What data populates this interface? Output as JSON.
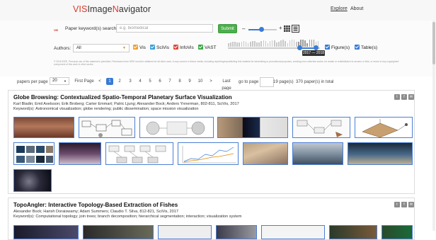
{
  "nav": {
    "brand": {
      "p1": "VIS",
      "p2": "Image",
      "p3": "N",
      "p4": "avigator"
    },
    "explore": "Explore",
    "about": "About"
  },
  "search": {
    "logo_text": "VIS",
    "label": "Paper keyword(s) search:",
    "placeholder": "e.g. biomedical",
    "submit": "Submit",
    "minus": "–",
    "plus": "+"
  },
  "filters": {
    "authors_label": "Authors:",
    "authors_value": "All",
    "venues": [
      {
        "label": "Vis",
        "color": "#f0a030"
      },
      {
        "label": "SciVis",
        "color": "#3a9fd8"
      },
      {
        "label": "InfoVis",
        "color": "#e0483a"
      },
      {
        "label": "VAST",
        "color": "#3aa845"
      }
    ],
    "year_range_text": "2017 — 2018",
    "year_range_fraction": [
      0.78,
      0.96
    ],
    "figure_label": "Figure(s)",
    "table_label": "Table(s)",
    "type_color": "#3a7bd5"
  },
  "disclaimer": "© 2018 IEEE. Personal use of this material is permitted. Permission from IEEE must be obtained for all other uses, in any current or future media, including reprinting/republishing this material for advertising or promotional purposes, creating new collective works, for resale or redistribution to servers or lists, or reuse of any copyrighted component of this work in other works.",
  "pager": {
    "per_page_label": "papers per page",
    "per_page_value": "20",
    "first": "First Page",
    "prev": "<",
    "pages": [
      "1",
      "2",
      "3",
      "4",
      "5",
      "6",
      "7",
      "8",
      "9",
      "10"
    ],
    "next": ">",
    "last": "Last page",
    "goto": "go to page",
    "total_pages": "19 page(s)",
    "total_papers": "370 paper(s) in total"
  },
  "papers": [
    {
      "title": "Globe Browsing: Contextualized Spatio-Temporal Planetary Surface Visualization",
      "authors": "Karl Bladin; Emil Axelsson; Erik Broberg; Carter Emmart; Patric Ljung; Alexander Bock; Anders Ynnerman, 802-811, SciVis, 2017",
      "keywords": "Keyword(s): Astronomical visualization; globe rendering; public dissemination; space mission visualization"
    },
    {
      "title": "TopoAngler: Interactive Topology-Based Extraction of Fishes",
      "authors": "Alexander Bock; Harish Doraiswamy; Adam Summers; Claudio T. Silva, 812-821, SciVis, 2017",
      "keywords": "Keyword(s): Computational topology; join trees; branch decomposition; hierarchical segmentation; interaction; visualization system"
    }
  ],
  "share_icons": [
    "twitter-icon",
    "facebook-icon",
    "email-icon"
  ]
}
